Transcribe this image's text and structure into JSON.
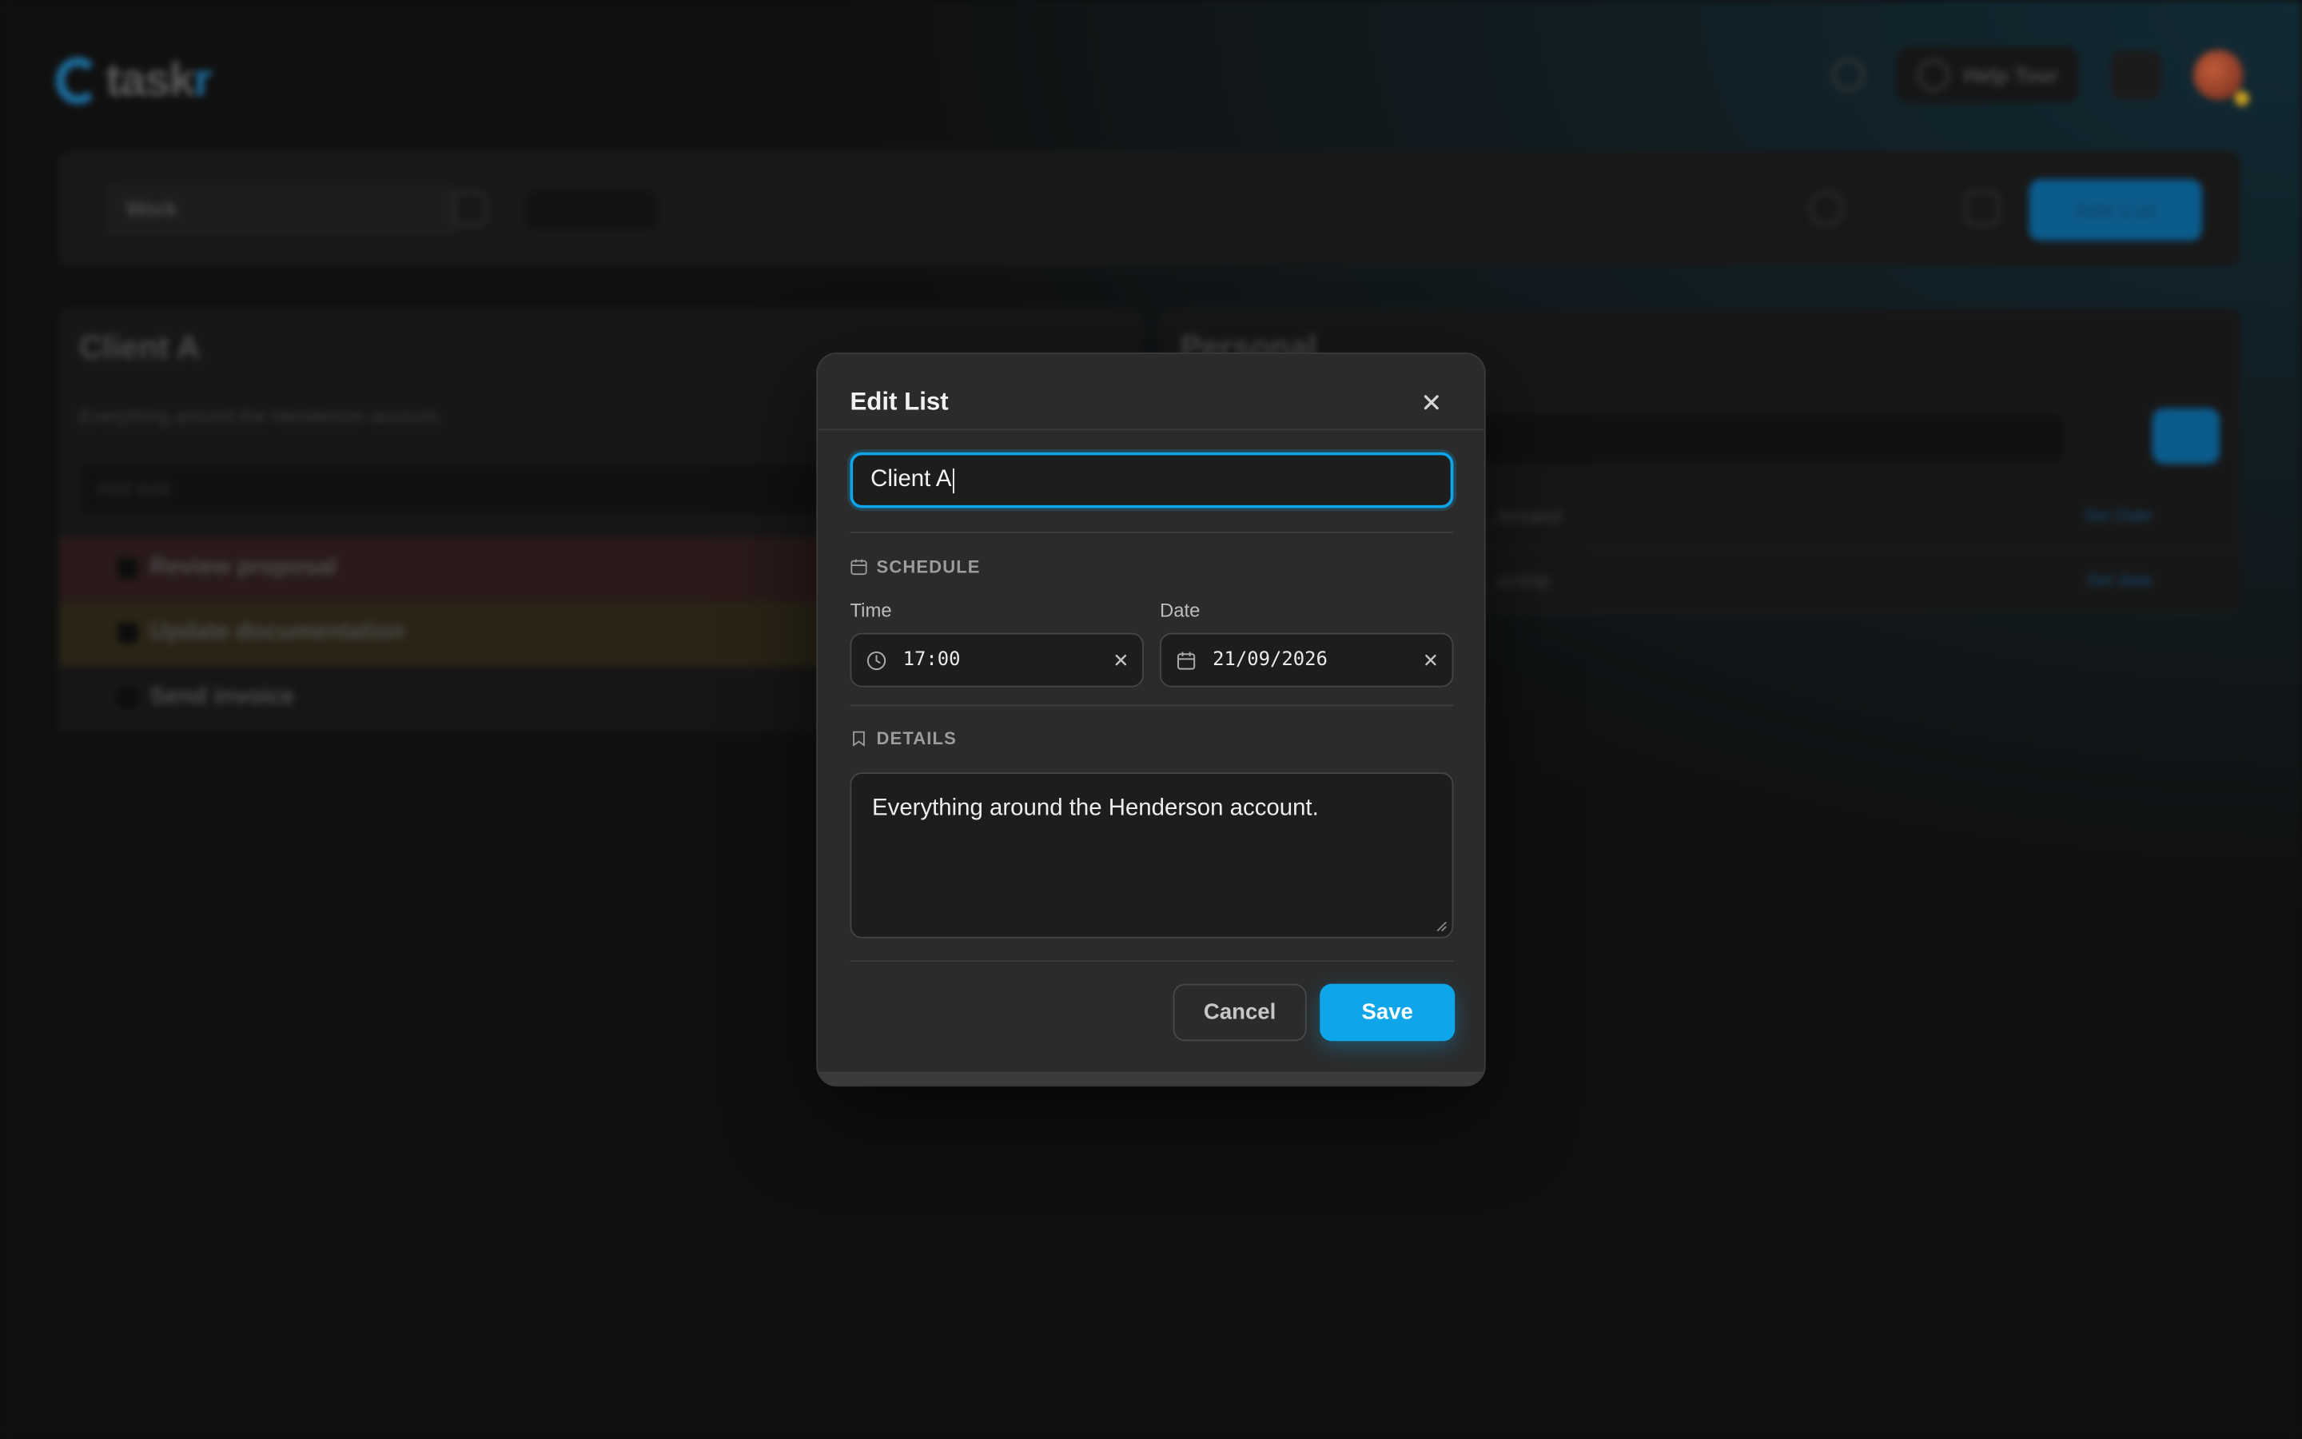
{
  "app": {
    "logo_text": "task",
    "logo_accent": "r",
    "help_label": "Help Tour",
    "workspace_select": "Work",
    "add_list_label": "Add List",
    "accent_color": "#0ea5e9"
  },
  "lists": [
    {
      "title": "Client A",
      "subtitle": "Everything around the Henderson account.",
      "input_placeholder": "Add task",
      "tasks": [
        "Review proposal",
        "Update documentation",
        "Send invoice"
      ]
    },
    {
      "title": "Personal",
      "rows": [
        {
          "text": "...lemand",
          "link": "Set Date"
        },
        {
          "text": "...ership",
          "link": "Set date"
        }
      ]
    }
  ],
  "modal": {
    "title": "Edit List",
    "name_value": "Client A",
    "schedule_heading": "SCHEDULE",
    "time_label": "Time",
    "time_value": "17:00",
    "date_label": "Date",
    "date_value": "21/09/2026",
    "details_heading": "DETAILS",
    "details_value": "Everything around the Henderson account.",
    "cancel_label": "Cancel",
    "save_label": "Save"
  }
}
